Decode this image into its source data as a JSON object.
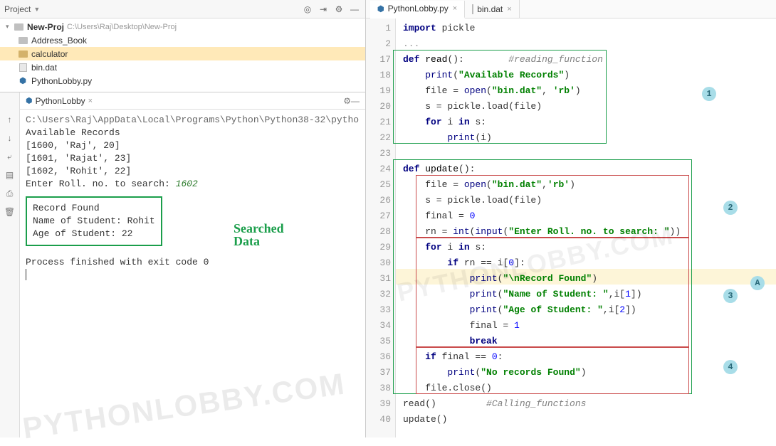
{
  "project_panel": {
    "title": "Project",
    "root": {
      "name": "New-Proj",
      "path": "C:\\Users\\Raj\\Desktop\\New-Proj"
    },
    "items": [
      {
        "name": "Address_Book"
      },
      {
        "name": "calculator"
      },
      {
        "name": "bin.dat"
      },
      {
        "name": "PythonLobby.py"
      }
    ]
  },
  "run_panel": {
    "tab": "PythonLobby",
    "path": "C:\\Users\\Raj\\AppData\\Local\\Programs\\Python\\Python38-32\\pytho",
    "lines": [
      "Available Records",
      "[1600, 'Raj', 20]",
      "[1601, 'Rajat', 23]",
      "[1602, 'Rohit', 22]"
    ],
    "prompt_label": "Enter Roll. no. to search:",
    "prompt_value": "1602",
    "record": {
      "l1": "Record Found",
      "l2": "Name of Student:  Rohit",
      "l3": "Age of Student:  22"
    },
    "annotation_l1": "Searched",
    "annotation_l2": "Data",
    "exit": "Process finished with exit code 0"
  },
  "editor": {
    "tabs": [
      {
        "label": "PythonLobby.py"
      },
      {
        "label": "bin.dat"
      }
    ],
    "gutter": [
      "1",
      "2",
      "17",
      "18",
      "19",
      "20",
      "21",
      "22",
      "23",
      "24",
      "25",
      "26",
      "27",
      "28",
      "29",
      "30",
      "31",
      "32",
      "33",
      "34",
      "35",
      "36",
      "37",
      "38",
      "39",
      "40"
    ]
  },
  "chart_data": {
    "type": "table",
    "title": "Source code — PythonLobby.py",
    "lines": [
      {
        "n": 1,
        "text": "import pickle"
      },
      {
        "n": 2,
        "text": "..."
      },
      {
        "n": 17,
        "text": "def read():        #reading_function"
      },
      {
        "n": 18,
        "text": "    print(\"Available Records\")"
      },
      {
        "n": 19,
        "text": "    file = open(\"bin.dat\", 'rb')"
      },
      {
        "n": 20,
        "text": "    s = pickle.load(file)"
      },
      {
        "n": 21,
        "text": "    for i in s:"
      },
      {
        "n": 22,
        "text": "        print(i)"
      },
      {
        "n": 23,
        "text": ""
      },
      {
        "n": 24,
        "text": "def update():"
      },
      {
        "n": 25,
        "text": "    file = open(\"bin.dat\",'rb')"
      },
      {
        "n": 26,
        "text": "    s = pickle.load(file)"
      },
      {
        "n": 27,
        "text": "    final = 0"
      },
      {
        "n": 28,
        "text": "    rn = int(input(\"Enter Roll. no. to search: \"))"
      },
      {
        "n": 29,
        "text": "    for i in s:"
      },
      {
        "n": 30,
        "text": "        if rn == i[0]:"
      },
      {
        "n": 31,
        "text": "            print(\"\\nRecord Found\")"
      },
      {
        "n": 32,
        "text": "            print(\"Name of Student: \",i[1])"
      },
      {
        "n": 33,
        "text": "            print(\"Age of Student: \",i[2])"
      },
      {
        "n": 34,
        "text": "            final = 1"
      },
      {
        "n": 35,
        "text": "            break"
      },
      {
        "n": 36,
        "text": "    if final == 0:"
      },
      {
        "n": 37,
        "text": "        print(\"No records Found\")"
      },
      {
        "n": 38,
        "text": "    file.close()"
      },
      {
        "n": 39,
        "text": "read()         #Calling_functions"
      },
      {
        "n": 40,
        "text": "update()"
      }
    ],
    "annotation_regions": [
      {
        "id": "1",
        "lines": [
          17,
          22
        ],
        "color": "green"
      },
      {
        "id": "2",
        "lines": [
          25,
          28
        ],
        "color": "red"
      },
      {
        "id": "3",
        "lines": [
          29,
          35
        ],
        "color": "red"
      },
      {
        "id": "4",
        "lines": [
          36,
          38
        ],
        "color": "red"
      },
      {
        "id": "A",
        "lines": [
          24,
          38
        ],
        "color": "green"
      }
    ]
  },
  "badges": {
    "b1": "1",
    "b2": "2",
    "b3": "3",
    "b4": "4",
    "bA": "A"
  },
  "watermark": "PYTHONLOBBY.COM"
}
